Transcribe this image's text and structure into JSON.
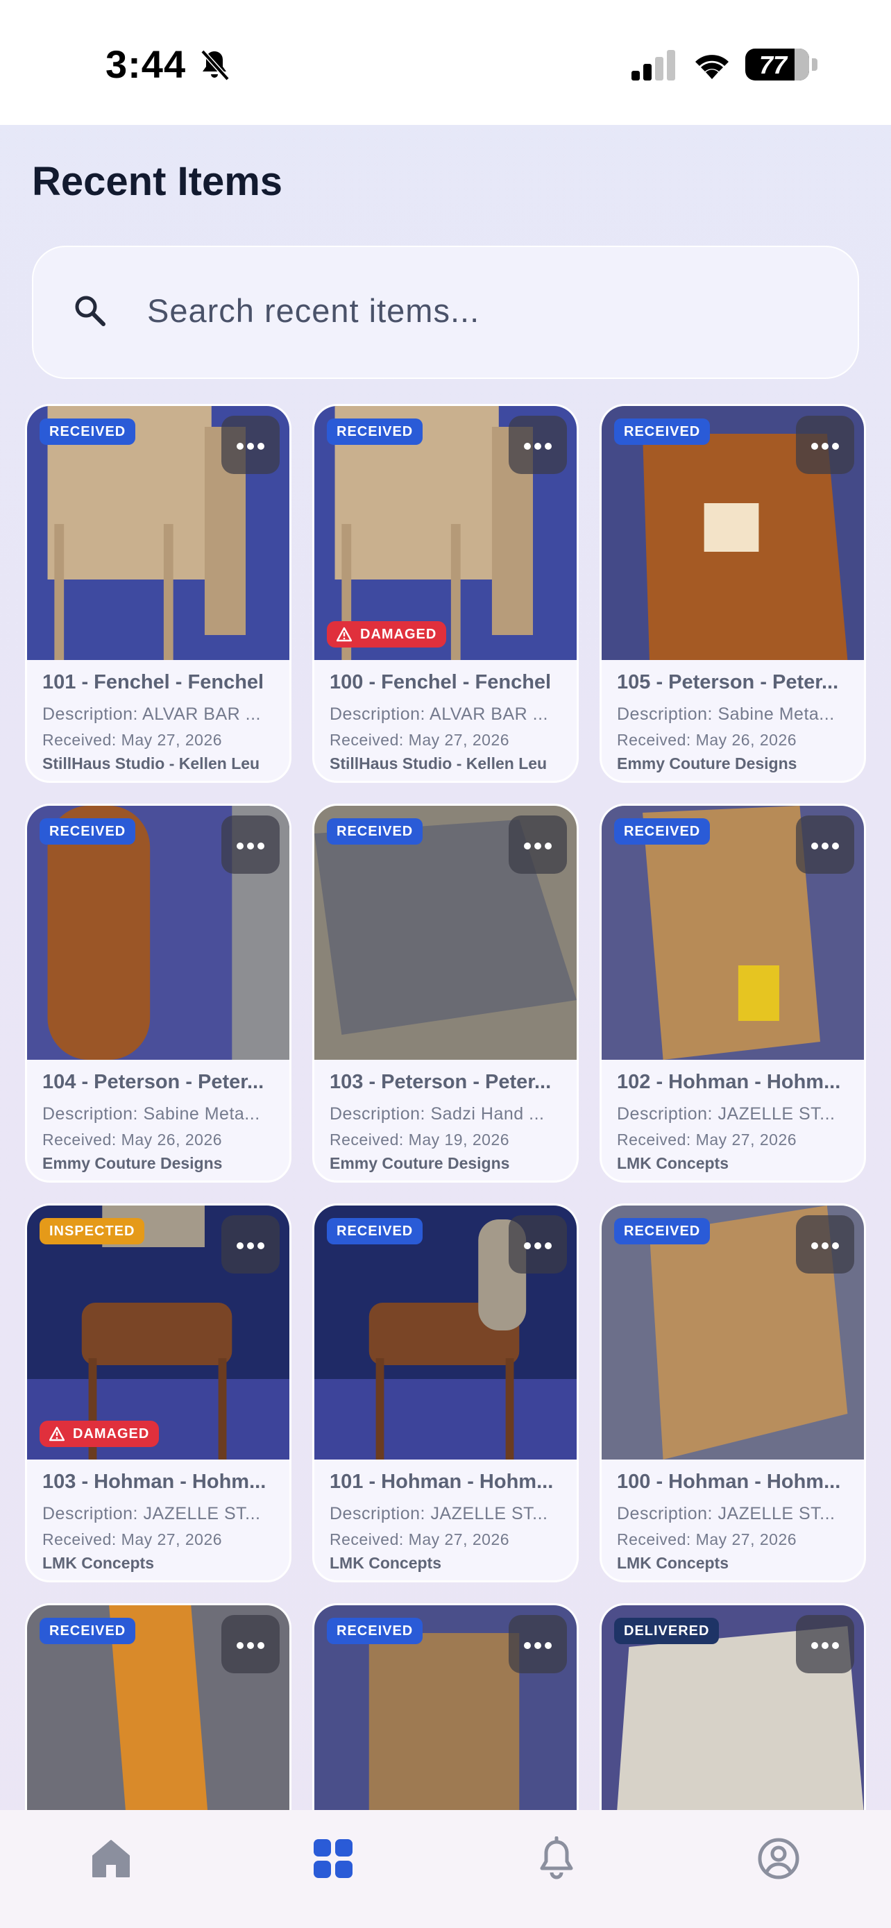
{
  "status_bar": {
    "time": "3:44",
    "battery": "77",
    "battery_level": 0.77
  },
  "page_title": "Recent Items",
  "search": {
    "placeholder": "Search recent items..."
  },
  "items": [
    {
      "status": "RECEIVED",
      "damaged": false,
      "title": "101 - Fenchel - Fenchel",
      "description": "Description: ALVAR BAR ...",
      "received": "Received: May 27, 2026",
      "vendor": "StillHaus Studio - Kellen Leu"
    },
    {
      "status": "RECEIVED",
      "damaged": true,
      "title": "100 - Fenchel - Fenchel",
      "description": "Description: ALVAR BAR ...",
      "received": "Received: May 27, 2026",
      "vendor": "StillHaus Studio - Kellen Leu"
    },
    {
      "status": "RECEIVED",
      "damaged": false,
      "title": "105 - Peterson - Peter...",
      "description": "Description: Sabine Meta...",
      "received": "Received: May 26, 2026",
      "vendor": "Emmy Couture Designs"
    },
    {
      "status": "RECEIVED",
      "damaged": false,
      "title": "104 - Peterson - Peter...",
      "description": "Description: Sabine Meta...",
      "received": "Received: May 26, 2026",
      "vendor": "Emmy Couture Designs"
    },
    {
      "status": "RECEIVED",
      "damaged": false,
      "title": "103 - Peterson - Peter...",
      "description": "Description: Sadzi Hand ...",
      "received": "Received: May 19, 2026",
      "vendor": "Emmy Couture Designs"
    },
    {
      "status": "RECEIVED",
      "damaged": false,
      "title": "102 - Hohman - Hohm...",
      "description": "Description: JAZELLE ST...",
      "received": "Received: May 27, 2026",
      "vendor": "LMK Concepts"
    },
    {
      "status": "INSPECTED",
      "damaged": true,
      "title": "103 - Hohman - Hohm...",
      "description": "Description: JAZELLE ST...",
      "received": "Received: May 27, 2026",
      "vendor": "LMK Concepts"
    },
    {
      "status": "RECEIVED",
      "damaged": false,
      "title": "101 - Hohman - Hohm...",
      "description": "Description: JAZELLE ST...",
      "received": "Received: May 27, 2026",
      "vendor": "LMK Concepts"
    },
    {
      "status": "RECEIVED",
      "damaged": false,
      "title": "100 - Hohman - Hohm...",
      "description": "Description: JAZELLE ST...",
      "received": "Received: May 27, 2026",
      "vendor": "LMK Concepts"
    },
    {
      "status": "RECEIVED",
      "damaged": false,
      "title": "",
      "description": "",
      "received": "",
      "vendor": ""
    },
    {
      "status": "RECEIVED",
      "damaged": false,
      "title": "",
      "description": "",
      "received": "",
      "vendor": ""
    },
    {
      "status": "DELIVERED",
      "damaged": false,
      "title": "",
      "description": "",
      "received": "",
      "vendor": ""
    }
  ],
  "damaged_label": "DAMAGED",
  "nav": [
    {
      "icon": "home-icon",
      "active": false
    },
    {
      "icon": "grid-icon",
      "active": true
    },
    {
      "icon": "bell-icon",
      "active": false
    },
    {
      "icon": "profile-icon",
      "active": false
    }
  ],
  "colors": {
    "accent": "#2a5bd7",
    "inactive": "#8b8f9e",
    "damaged": "#e0303c",
    "inspected": "#e59a19"
  }
}
